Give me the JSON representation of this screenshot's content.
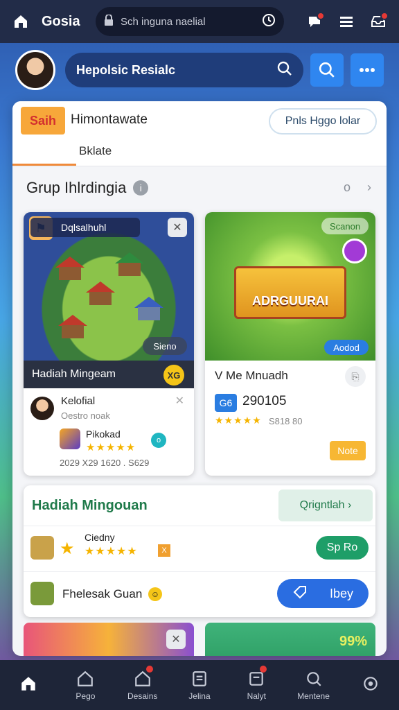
{
  "topbar": {
    "title": "Gosia",
    "url": "Sch inguna naelial"
  },
  "search": {
    "value": "Hepolsic Resialc"
  },
  "panel_header": {
    "tag": "Saih",
    "title": "Himontawate",
    "subtitle": "Bklate",
    "pill": "Pnls Hggo lolar"
  },
  "section": {
    "title": "Grup Ihlrdingia",
    "info": "i",
    "right_text": "o"
  },
  "card_left": {
    "chip": "Dqlsalhuhl",
    "badge": "Sieno",
    "footer_title": "Hadiah Mingeam",
    "coin": "XG",
    "user_name": "Kelofial",
    "user_sub": "Oestro noak",
    "app_name": "Pikokad",
    "app_stars": "★★★★★",
    "teal": "o",
    "meta": "2029  X29  1620 . S629"
  },
  "card_right": {
    "chip": "Scanon",
    "banner": "ADRGUURAI",
    "blue_chip": "Aodod",
    "title": "V Me Mnuadh",
    "badge": "G6",
    "number": "290105",
    "stars": "★★★★★",
    "meta": "S818  80",
    "button": "Note"
  },
  "list": {
    "title": "Hadiah Mingouan",
    "pill": "Qrigntlah ›",
    "row1": {
      "name": "Ciedny",
      "stars": "★★★★★",
      "x": "X",
      "button": "Sp Ro"
    },
    "row2": {
      "name": "Fhelesak Guan",
      "button": "Ibey"
    }
  },
  "peek": {
    "percent": "99%"
  },
  "nav": [
    {
      "label": "",
      "icon": "home-icon"
    },
    {
      "label": "Pego",
      "icon": "house-outline-icon"
    },
    {
      "label": "Desains",
      "icon": "house-badge-icon"
    },
    {
      "label": "Jelina",
      "icon": "list-icon"
    },
    {
      "label": "Nalyt",
      "icon": "inbox-icon"
    },
    {
      "label": "Mentene",
      "icon": "search-icon"
    },
    {
      "label": "",
      "icon": "settings-icon"
    }
  ],
  "colors": {
    "accent": "#2f86f0",
    "green": "#1e9e68",
    "orange": "#f7a73a"
  }
}
